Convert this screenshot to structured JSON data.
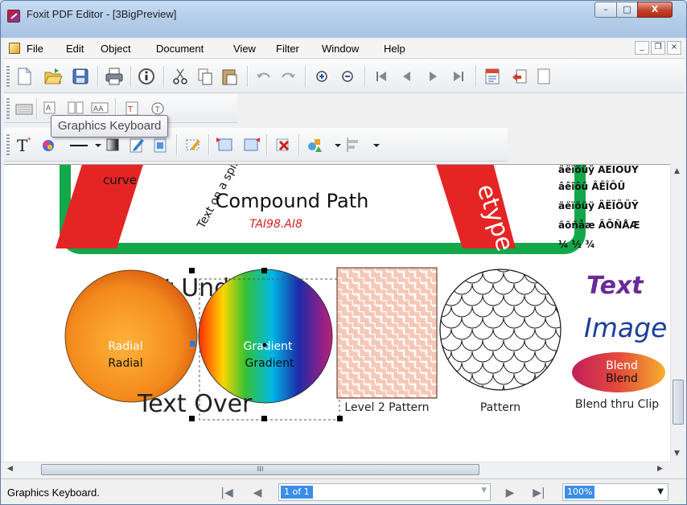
{
  "window": {
    "title": "Foxit PDF Editor - [3BigPreview]",
    "minimize_glyph": "–",
    "maximize_glyph": "□",
    "close_glyph": "X"
  },
  "menu": {
    "items": [
      "File",
      "Edit",
      "Object",
      "Document",
      "View",
      "Filter",
      "Window",
      "Help"
    ],
    "mdi_min": "_",
    "mdi_restore": "❐",
    "mdi_close": "×"
  },
  "tooltip": "Graphics Keyboard",
  "document": {
    "curve_label": "curve",
    "spiral_text": "Text on a spiral. Four score",
    "compound_title": "Compound Path",
    "compound_file": "TAI98.AI8",
    "red_band_text": "etype",
    "accent_lines": [
      "äëïöüÿ ÄËÏÖÜŸ",
      "âêîôû ÂÊÎÔÛ",
      "äëïöüÿ ÄËÏÖÜŸ",
      "ãõñåæ ÃÕÑÅÆ",
      "¼ ½ ¾"
    ],
    "text_under": "Text Und",
    "text_over": "Text Over",
    "radial_top": "Radial",
    "radial_bottom": "Radial",
    "gradient_top": "Gradient",
    "gradient_bottom": "Gradient",
    "level2_caption": "Level 2 Pattern",
    "pattern_caption": "Pattern",
    "text_word": "Text",
    "image_word": "Image",
    "blend_top": "Blend",
    "blend_bottom": "Blend",
    "blend_caption": "Blend thru Clip"
  },
  "hscroll_grip": "III",
  "status": {
    "text": "Graphics Keyboard.",
    "page_value": "1 of 1",
    "zoom_value": "100%"
  },
  "colors": {
    "accent_green": "#12a84a",
    "band_red": "#e52424",
    "selection": "#3b8ee8",
    "text_blue": "#1c3f9b",
    "text_purple": "#6a2a9a"
  }
}
